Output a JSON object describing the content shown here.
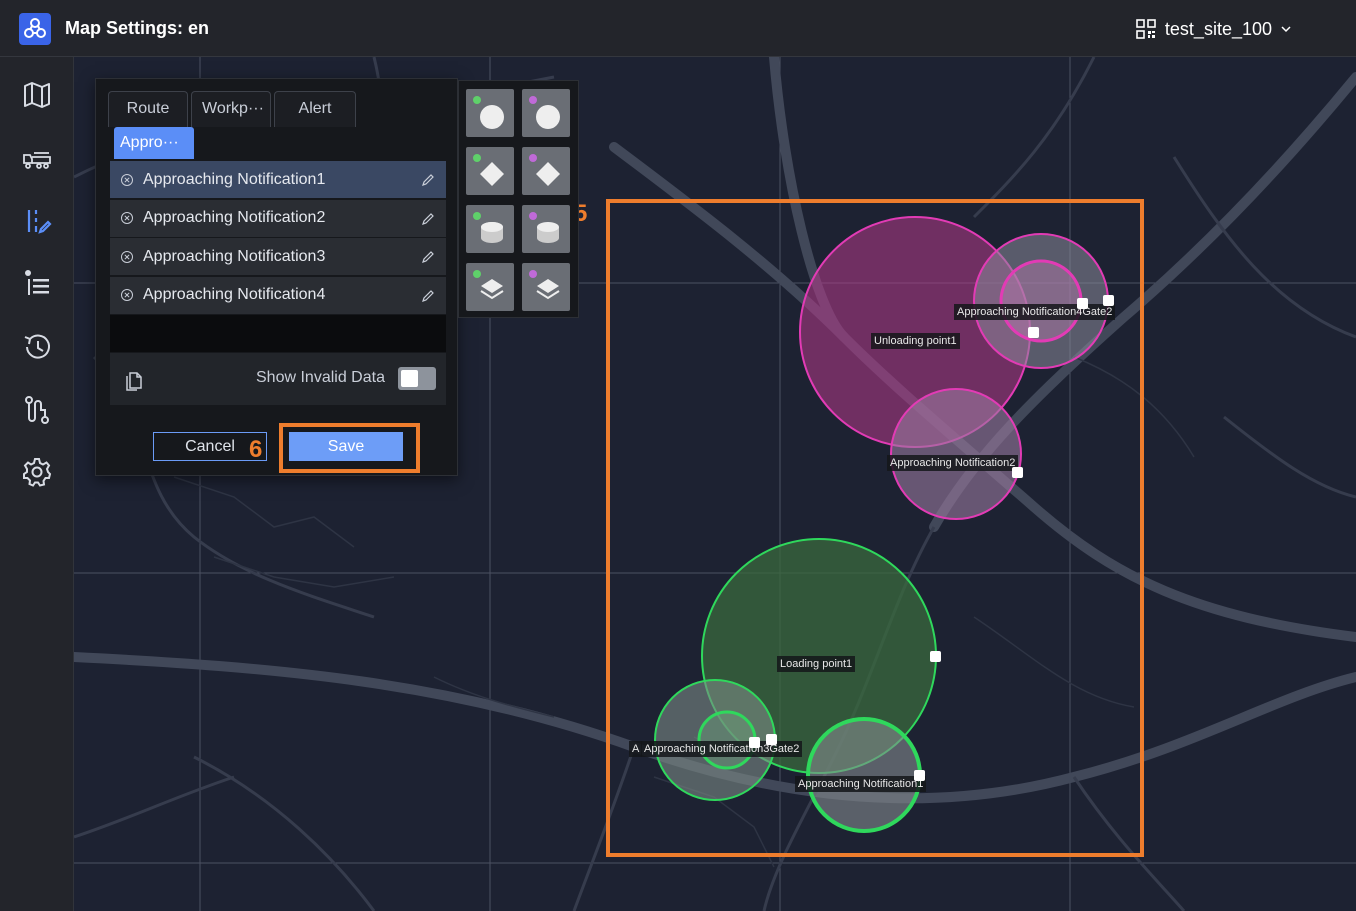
{
  "header": {
    "title": "Map Settings: en",
    "site_name": "test_site_100"
  },
  "sidebar": {
    "items": [
      {
        "name": "map",
        "icon": "map-icon"
      },
      {
        "name": "vehicles",
        "icon": "truck-icon"
      },
      {
        "name": "route-edit",
        "icon": "route-edit-icon",
        "active": true
      },
      {
        "name": "list",
        "icon": "list-icon"
      },
      {
        "name": "history",
        "icon": "history-icon"
      },
      {
        "name": "path",
        "icon": "path-icon"
      },
      {
        "name": "settings",
        "icon": "gear-icon"
      }
    ]
  },
  "panel": {
    "tabs": [
      "Route",
      "Workp···",
      "Alert"
    ],
    "active_tab": "Appro···",
    "items": [
      {
        "label": "Approaching Notification1",
        "selected": true
      },
      {
        "label": "Approaching Notification2",
        "selected": false
      },
      {
        "label": "Approaching Notification3",
        "selected": false
      },
      {
        "label": "Approaching Notification4",
        "selected": false
      }
    ],
    "show_invalid_label": "Show Invalid Data",
    "show_invalid_value": false,
    "cancel_label": "Cancel",
    "save_label": "Save"
  },
  "palette": {
    "shapes": [
      "circle-green",
      "circle-purple",
      "diamond-green",
      "diamond-purple",
      "cylinder-green",
      "cylinder-purple",
      "layers-green",
      "layers-purple"
    ]
  },
  "map": {
    "labels": [
      "Approaching Notification4Gate2",
      "Unloading point1",
      "Approaching Notification2",
      "Loading point1",
      "A",
      "Approaching Notification3Gate2",
      "Approaching Notification1"
    ]
  },
  "annotations": {
    "box5_number": "5",
    "box6_number": "6"
  },
  "colors": {
    "accent": "#5b8ef7",
    "annotation": "#ee7d2d",
    "magenta_zone": "#e23bb5",
    "green_zone": "#2fd85c"
  }
}
